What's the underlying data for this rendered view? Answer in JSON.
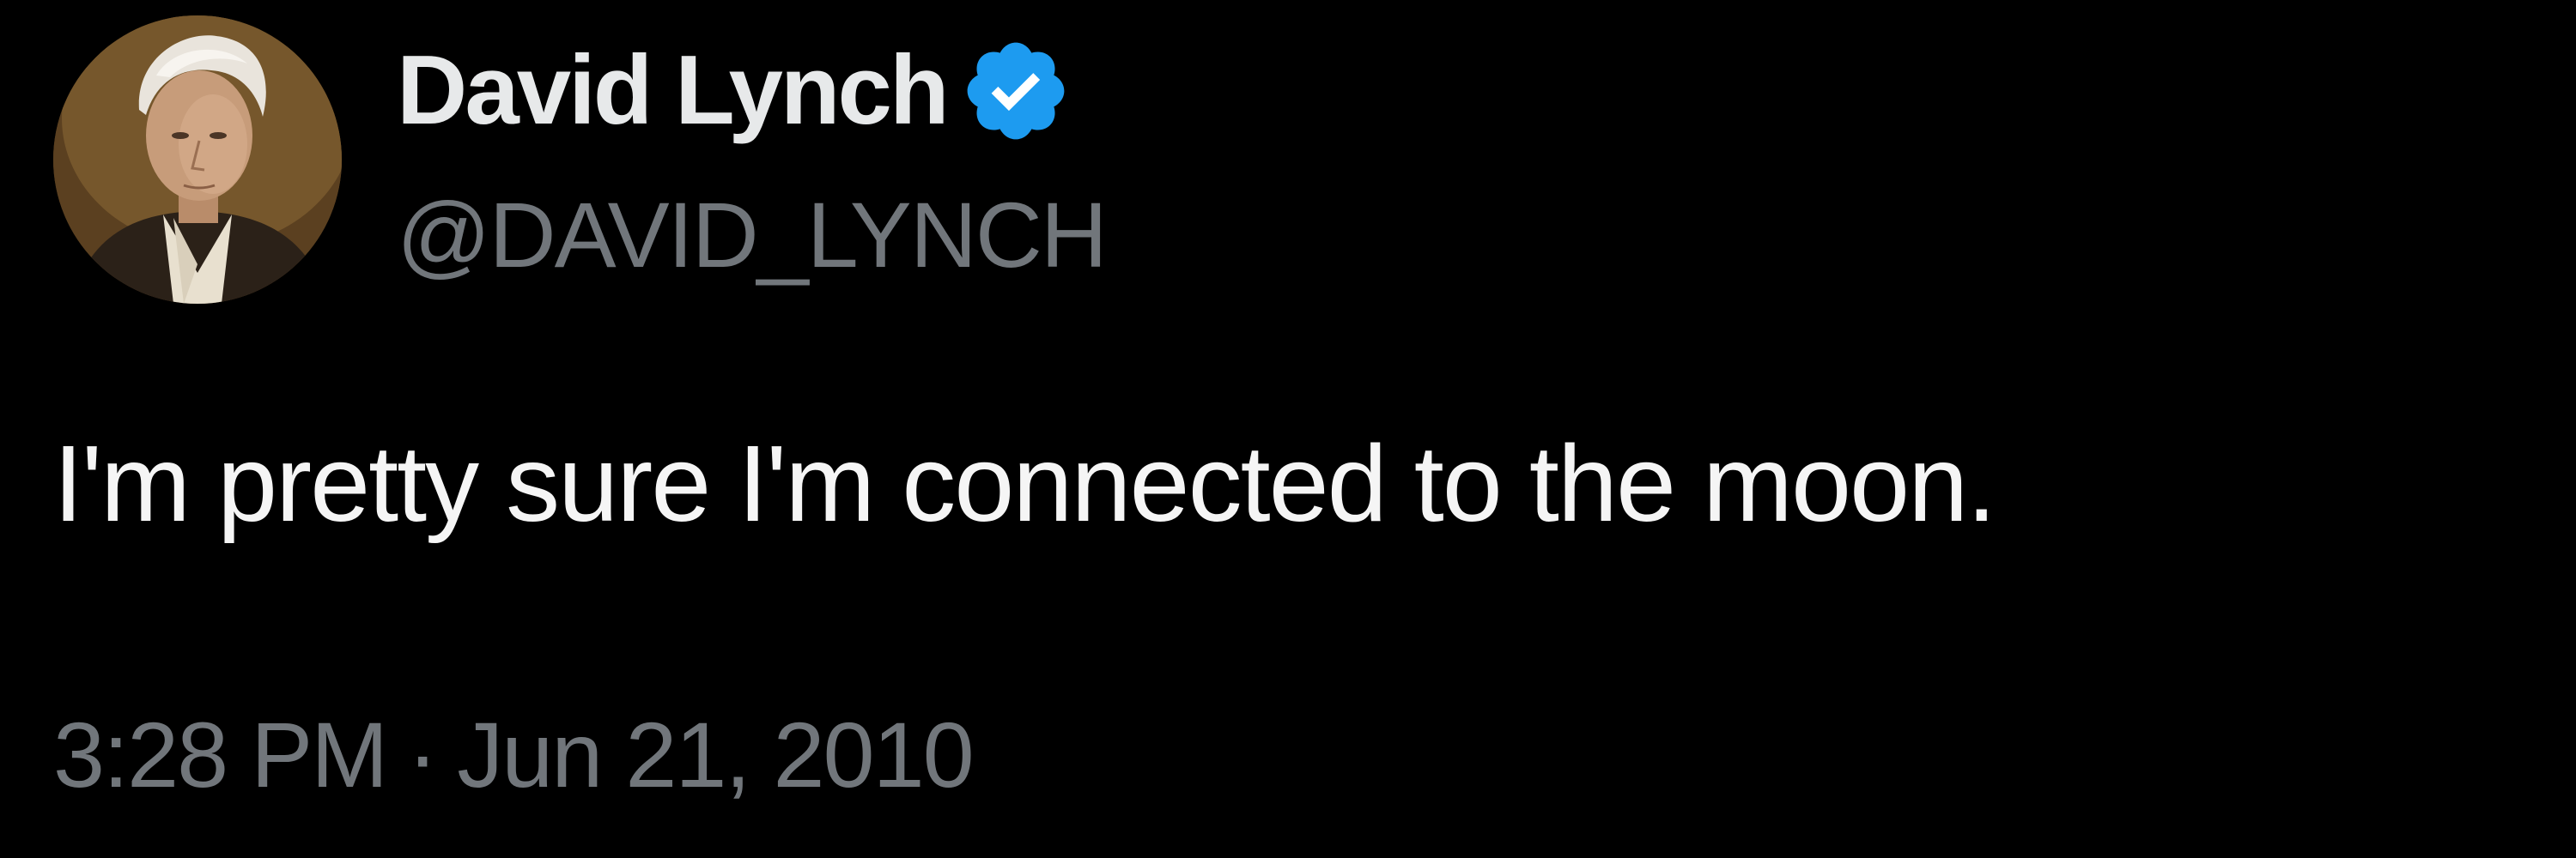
{
  "tweet": {
    "author": {
      "display_name": "David Lynch",
      "handle": "@DAVID_LYNCH",
      "verified": true,
      "verified_badge_color": "#1d9bf0",
      "avatar_icon": "avatar-portrait"
    },
    "text": "I'm pretty sure I'm connected to the moon.",
    "time": "3:28 PM",
    "separator": "·",
    "date": "Jun 21, 2010"
  },
  "colors": {
    "background": "#000000",
    "primary_text": "#e7e9ea",
    "secondary_text": "#71767b",
    "accent": "#1d9bf0"
  }
}
